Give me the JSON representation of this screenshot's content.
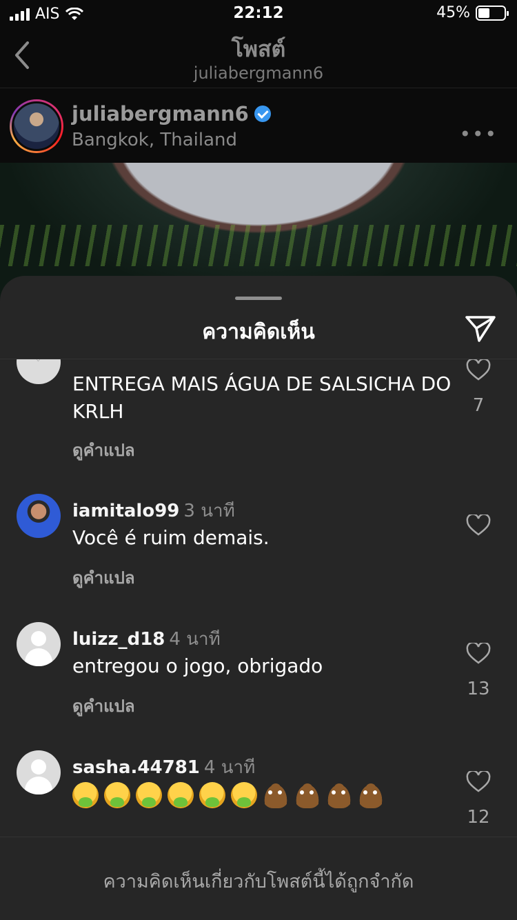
{
  "status_bar": {
    "carrier": "AIS",
    "time": "22:12",
    "battery": "45%",
    "battery_level": 0.45
  },
  "header": {
    "title": "โพสต์",
    "subtitle": "juliabergmann6"
  },
  "post": {
    "username": "juliabergmann6",
    "location": "Bangkok, Thailand",
    "more": "•••"
  },
  "sheet": {
    "title": "ความคิดเห็น",
    "footer_note": "ความคิดเห็นเกี่ยวกับโพสต์นี้ได้ถูกจำกัด"
  },
  "comments": [
    {
      "user": "",
      "time": "",
      "text": "ENTREGA MAIS ÁGUA DE SALSICHA DO KRLH",
      "translate": "ดูคำแปล",
      "likes": "7"
    },
    {
      "user": "iamitalo99",
      "time": "3 นาที",
      "text": "Você é ruim demais.",
      "translate": "ดูคำแปล",
      "likes": ""
    },
    {
      "user": "luizz_d18",
      "time": "4 นาที",
      "text": "entregou o jogo, obrigado",
      "translate": "ดูคำแปล",
      "likes": "13"
    },
    {
      "user": "sasha.44781",
      "time": "4 นาที",
      "text": "",
      "emojis": [
        "nauseated-face",
        "nauseated-face",
        "nauseated-face",
        "nauseated-face",
        "nauseated-face",
        "nauseated-face",
        "pile-of-poo",
        "pile-of-poo",
        "pile-of-poo",
        "pile-of-poo"
      ],
      "likes": "12"
    }
  ],
  "colors": {
    "sheet_bg": "#262626",
    "accent_verified": "#3897f0"
  }
}
